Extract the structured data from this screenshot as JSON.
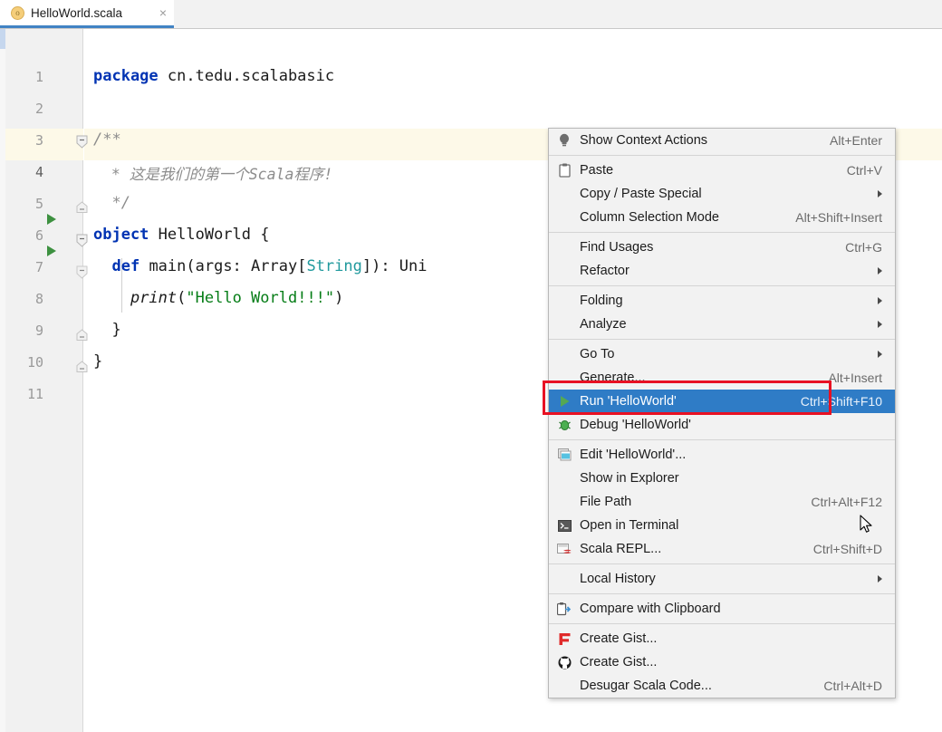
{
  "window": {
    "app": "IntelliJ IDEA",
    "tab": {
      "label": "HelloWorld.scala",
      "icon": "scala-object-icon",
      "close": "×"
    }
  },
  "editor": {
    "gutter_line_numbers": [
      "1",
      "2",
      "3",
      "4",
      "5",
      "6",
      "7",
      "8",
      "9",
      "10",
      "11"
    ],
    "current_line": "4",
    "run_markers_on_lines": [
      "6",
      "7"
    ],
    "lines": [
      {
        "n": "1",
        "tokens": [
          {
            "t": "package ",
            "c": "kw"
          },
          {
            "t": "cn.tedu.scalabasic",
            "c": "plain"
          }
        ]
      },
      {
        "n": "2",
        "tokens": []
      },
      {
        "n": "3",
        "tokens": [
          {
            "t": "/**",
            "c": "cmt"
          }
        ]
      },
      {
        "n": "4",
        "tokens": [
          {
            "t": "  * 这是我们的第一个Scala程序!",
            "c": "cmt"
          }
        ]
      },
      {
        "n": "5",
        "tokens": [
          {
            "t": "  */",
            "c": "cmt"
          }
        ]
      },
      {
        "n": "6",
        "tokens": [
          {
            "t": "object ",
            "c": "kw"
          },
          {
            "t": "HelloWorld {",
            "c": "plain"
          }
        ]
      },
      {
        "n": "7",
        "tokens": [
          {
            "t": "  ",
            "c": "plain"
          },
          {
            "t": "def ",
            "c": "kw"
          },
          {
            "t": "main(args: Array[",
            "c": "plain"
          },
          {
            "t": "String",
            "c": "typ"
          },
          {
            "t": "]): Uni",
            "c": "plain"
          }
        ]
      },
      {
        "n": "8",
        "tokens": [
          {
            "t": "    ",
            "c": "plain"
          },
          {
            "t": "print",
            "c": "fn"
          },
          {
            "t": "(",
            "c": "plain"
          },
          {
            "t": "\"Hello World!!!\"",
            "c": "str"
          },
          {
            "t": ")",
            "c": "plain"
          }
        ]
      },
      {
        "n": "9",
        "tokens": [
          {
            "t": "  }",
            "c": "plain"
          }
        ]
      },
      {
        "n": "10",
        "tokens": [
          {
            "t": "}",
            "c": "plain"
          }
        ]
      },
      {
        "n": "11",
        "tokens": []
      }
    ]
  },
  "context_menu": {
    "items": [
      {
        "icon": "lightbulb-icon",
        "label": "Show Context Actions",
        "accel": "Alt+Enter",
        "arrow": false,
        "selected": false,
        "mnemonic": ""
      },
      {
        "sep": true
      },
      {
        "icon": "clipboard-icon",
        "label": "Paste",
        "accel": "Ctrl+V",
        "arrow": false,
        "selected": false,
        "mnemonic": "P"
      },
      {
        "icon": "",
        "label": "Copy / Paste Special",
        "accel": "",
        "arrow": true,
        "selected": false,
        "mnemonic": ""
      },
      {
        "icon": "",
        "label": "Column Selection Mode",
        "accel": "Alt+Shift+Insert",
        "arrow": false,
        "selected": false,
        "mnemonic": "M"
      },
      {
        "sep": true
      },
      {
        "icon": "",
        "label": "Find Usages",
        "accel": "Ctrl+G",
        "arrow": false,
        "selected": false,
        "mnemonic": "U"
      },
      {
        "icon": "",
        "label": "Refactor",
        "accel": "",
        "arrow": true,
        "selected": false,
        "mnemonic": "R"
      },
      {
        "sep": true
      },
      {
        "icon": "",
        "label": "Folding",
        "accel": "",
        "arrow": true,
        "selected": false,
        "mnemonic": ""
      },
      {
        "icon": "",
        "label": "Analyze",
        "accel": "",
        "arrow": true,
        "selected": false,
        "mnemonic": "z"
      },
      {
        "sep": true
      },
      {
        "icon": "",
        "label": "Go To",
        "accel": "",
        "arrow": true,
        "selected": false,
        "mnemonic": ""
      },
      {
        "icon": "",
        "label": "Generate...",
        "accel": "Alt+Insert",
        "arrow": false,
        "selected": false,
        "mnemonic": ""
      },
      {
        "icon": "run-icon",
        "label": "Run 'HelloWorld'",
        "accel": "Ctrl+Shift+F10",
        "arrow": false,
        "selected": true,
        "mnemonic": "u"
      },
      {
        "icon": "debug-icon",
        "label": "Debug 'HelloWorld'",
        "accel": "",
        "arrow": false,
        "selected": false,
        "mnemonic": "D"
      },
      {
        "sep": true
      },
      {
        "icon": "edit-config-icon",
        "label": "Edit 'HelloWorld'...",
        "accel": "",
        "arrow": false,
        "selected": false,
        "mnemonic": ""
      },
      {
        "icon": "",
        "label": "Show in Explorer",
        "accel": "",
        "arrow": false,
        "selected": false,
        "mnemonic": ""
      },
      {
        "icon": "",
        "label": "File Path",
        "accel": "Ctrl+Alt+F12",
        "arrow": false,
        "selected": false,
        "mnemonic": "P"
      },
      {
        "icon": "terminal-icon",
        "label": "Open in Terminal",
        "accel": "",
        "arrow": false,
        "selected": false,
        "mnemonic": ""
      },
      {
        "icon": "scala-repl-icon",
        "label": "Scala REPL...",
        "accel": "Ctrl+Shift+D",
        "arrow": false,
        "selected": false,
        "mnemonic": ""
      },
      {
        "sep": true
      },
      {
        "icon": "",
        "label": "Local History",
        "accel": "",
        "arrow": true,
        "selected": false,
        "mnemonic": "H"
      },
      {
        "sep": true
      },
      {
        "icon": "compare-icon",
        "label": "Compare with Clipboard",
        "accel": "",
        "arrow": false,
        "selected": false,
        "mnemonic": "b"
      },
      {
        "sep": true
      },
      {
        "icon": "gitlab-icon",
        "label": "Create Gist...",
        "accel": "",
        "arrow": false,
        "selected": false,
        "mnemonic": ""
      },
      {
        "icon": "github-icon",
        "label": "Create Gist...",
        "accel": "",
        "arrow": false,
        "selected": false,
        "mnemonic": ""
      },
      {
        "icon": "",
        "label": "Desugar Scala Code...",
        "accel": "Ctrl+Alt+D",
        "arrow": false,
        "selected": false,
        "mnemonic": ""
      }
    ]
  },
  "annotation": {
    "highlight_box_target": "Run 'HelloWorld'",
    "highlight_color": "#e81123"
  },
  "colors": {
    "selection_blue": "#2f7cc6",
    "tab_underline": "#4183c4",
    "keyword": "#0033b3",
    "string": "#067d17",
    "comment": "#8c8c8c",
    "type": "#20999d",
    "run_green": "#3d9140",
    "current_line_bg": "#fdf9e8"
  }
}
